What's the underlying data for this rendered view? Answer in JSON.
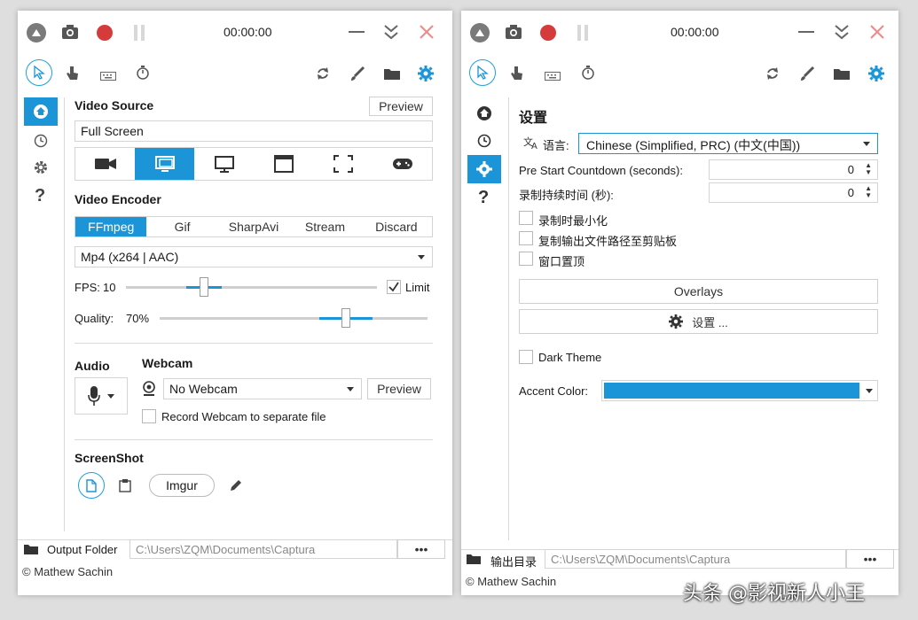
{
  "left": {
    "time": "00:00:00",
    "video_source": {
      "label": "Video Source",
      "preview": "Preview",
      "value": "Full Screen"
    },
    "video_encoder": {
      "label": "Video Encoder",
      "tabs": [
        "FFmpeg",
        "Gif",
        "SharpAvi",
        "Stream",
        "Discard"
      ],
      "active_tab": 0,
      "format": "Mp4 (x264 | AAC)"
    },
    "fps": {
      "label": "FPS:",
      "value": "10",
      "limit_label": "Limit",
      "level": 0.3
    },
    "quality": {
      "label": "Quality:",
      "value": "70%",
      "level": 0.7
    },
    "audio": {
      "label": "Audio"
    },
    "webcam": {
      "label": "Webcam",
      "value": "No Webcam",
      "preview": "Preview",
      "record_separate": "Record Webcam to separate file"
    },
    "screenshot": {
      "label": "ScreenShot",
      "imgur": "Imgur"
    },
    "output": {
      "label": "Output Folder",
      "path": "C:\\Users\\ZQM\\Documents\\Captura",
      "more": "•••"
    },
    "credit": "© Mathew Sachin"
  },
  "right": {
    "time": "00:00:00",
    "settings_title": "设置",
    "language": {
      "label": "语言:",
      "value": "Chinese (Simplified, PRC) (中文(中国))"
    },
    "countdown": {
      "label": "Pre Start Countdown (seconds):",
      "value": "0"
    },
    "duration": {
      "label": "录制持续时间 (秒):",
      "value": "0"
    },
    "checks": [
      "录制时最小化",
      "复制输出文件路径至剪贴板",
      "窗口置顶"
    ],
    "overlays_btn": "Overlays",
    "settings_btn": "设置 ...",
    "dark_theme": "Dark Theme",
    "accent": {
      "label": "Accent Color:",
      "color": "#1b95d8"
    },
    "output": {
      "label": "输出目录",
      "path": "C:\\Users\\ZQM\\Documents\\Captura",
      "more": "•••"
    },
    "credit": "© Mathew Sachin"
  },
  "watermark": "头条 @影视新人小王",
  "colors": {
    "accent": "#1b95d8",
    "record": "#d63b3b",
    "close": "#f08a8a"
  }
}
